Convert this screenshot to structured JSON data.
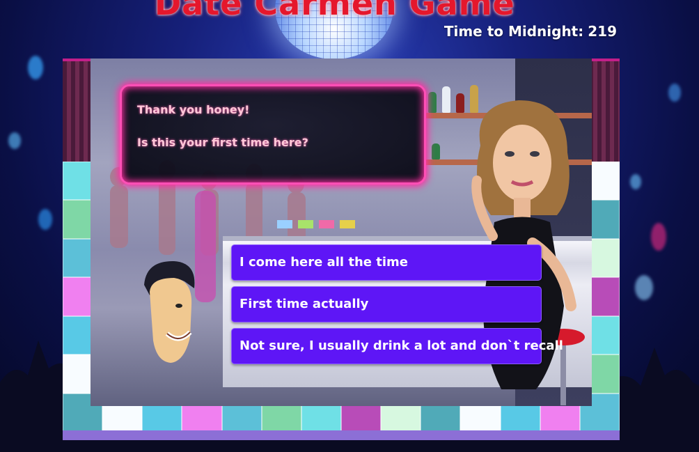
{
  "header": {
    "game_title": "Date Carmen Game",
    "timer_label": "Time to Midnight:",
    "timer_value": "219"
  },
  "dialogue": {
    "lines": [
      "Thank you honey!",
      "Is this your first time here?"
    ]
  },
  "answers": [
    {
      "label": "I come here all the time"
    },
    {
      "label": "First time actually"
    },
    {
      "label": "Not sure, I usually drink a lot and don`t recall"
    }
  ],
  "colors": {
    "title": "#e5172c",
    "answer_button": "#5e16f6",
    "bubble_border": "#ff4fb6",
    "floor_tiles": [
      "#6fe0e6",
      "#f8fcff",
      "#7fd7a6",
      "#50aab8",
      "#5cc0d8",
      "#d7f8e0",
      "#f080f0",
      "#b84cb8",
      "#58c9e6"
    ]
  }
}
